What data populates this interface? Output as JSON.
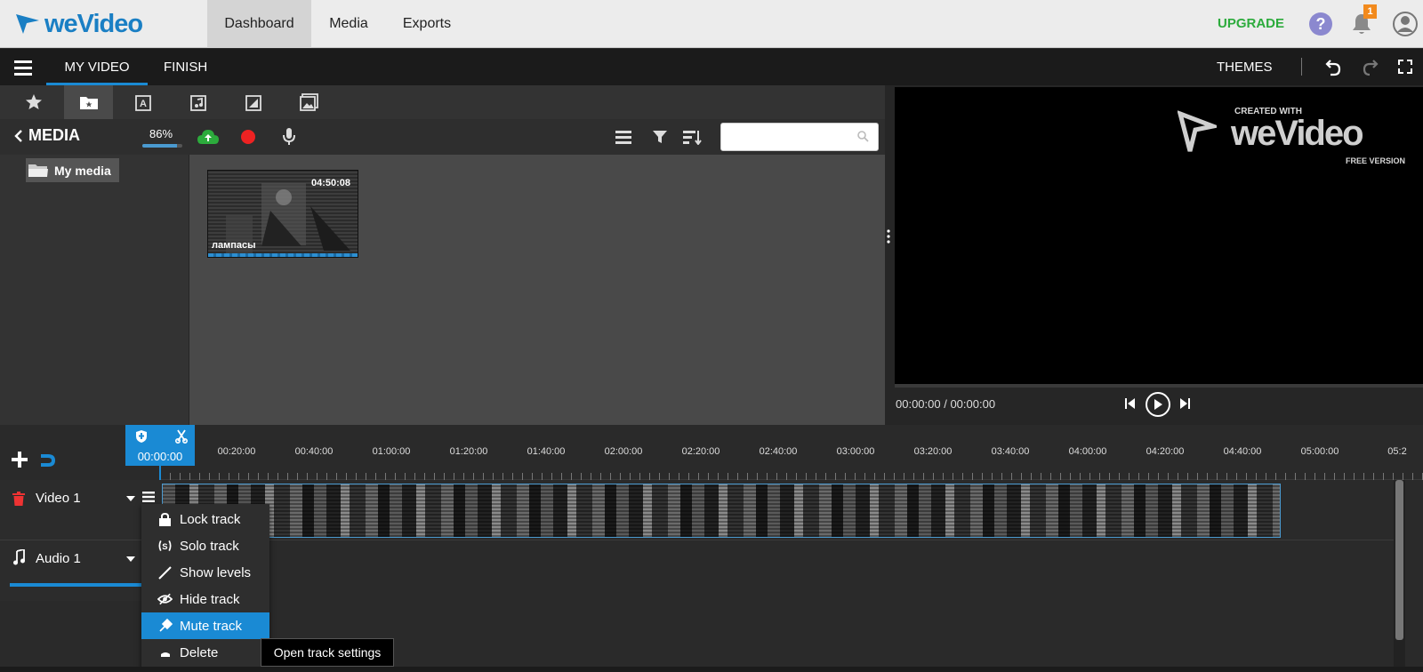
{
  "header": {
    "logo_text": "weVideo",
    "nav": [
      "Dashboard",
      "Media",
      "Exports"
    ],
    "upgrade_label": "UPGRADE",
    "help_label": "?",
    "notification_count": "1"
  },
  "editor_bar": {
    "tabs": [
      "MY VIDEO",
      "FINISH"
    ],
    "themes_label": "THEMES"
  },
  "media_panel": {
    "back_label": "MEDIA",
    "storage_percent": "86%",
    "storage_fraction": 0.86,
    "search_value": "",
    "folder_label": "My media",
    "clip": {
      "duration": "04:50:08",
      "name": "лампасы"
    }
  },
  "preview": {
    "timecode": "00:00:00 / 00:00:00",
    "watermark": {
      "created_with": "CREATED WITH",
      "logo": "weVideo",
      "free_version": "FREE VERSION"
    }
  },
  "timeline": {
    "playhead_time": "00:00:00",
    "ruler_labels": [
      "00:20:00",
      "00:40:00",
      "01:00:00",
      "01:20:00",
      "01:40:00",
      "02:00:00",
      "02:20:00",
      "02:40:00",
      "03:00:00",
      "03:20:00",
      "03:40:00",
      "04:00:00",
      "04:20:00",
      "04:40:00",
      "05:00:00",
      "05:2"
    ],
    "tracks": [
      {
        "name": "Video 1"
      },
      {
        "name": "Audio 1"
      }
    ]
  },
  "track_menu": {
    "items": [
      {
        "label": "Lock track",
        "icon": "lock-icon"
      },
      {
        "label": "Solo track",
        "icon": "solo-icon"
      },
      {
        "label": "Show levels",
        "icon": "levels-icon"
      },
      {
        "label": "Hide track",
        "icon": "eye-slash-icon"
      },
      {
        "label": "Mute track",
        "icon": "mute-icon",
        "selected": true
      },
      {
        "label": "Delete",
        "icon": "delete-icon"
      }
    ],
    "tooltip": "Open track settings"
  },
  "colors": {
    "accent": "#1a8ad4",
    "upgrade": "#2cab3c",
    "record": "#ee2222",
    "badge": "#f28a1d"
  }
}
